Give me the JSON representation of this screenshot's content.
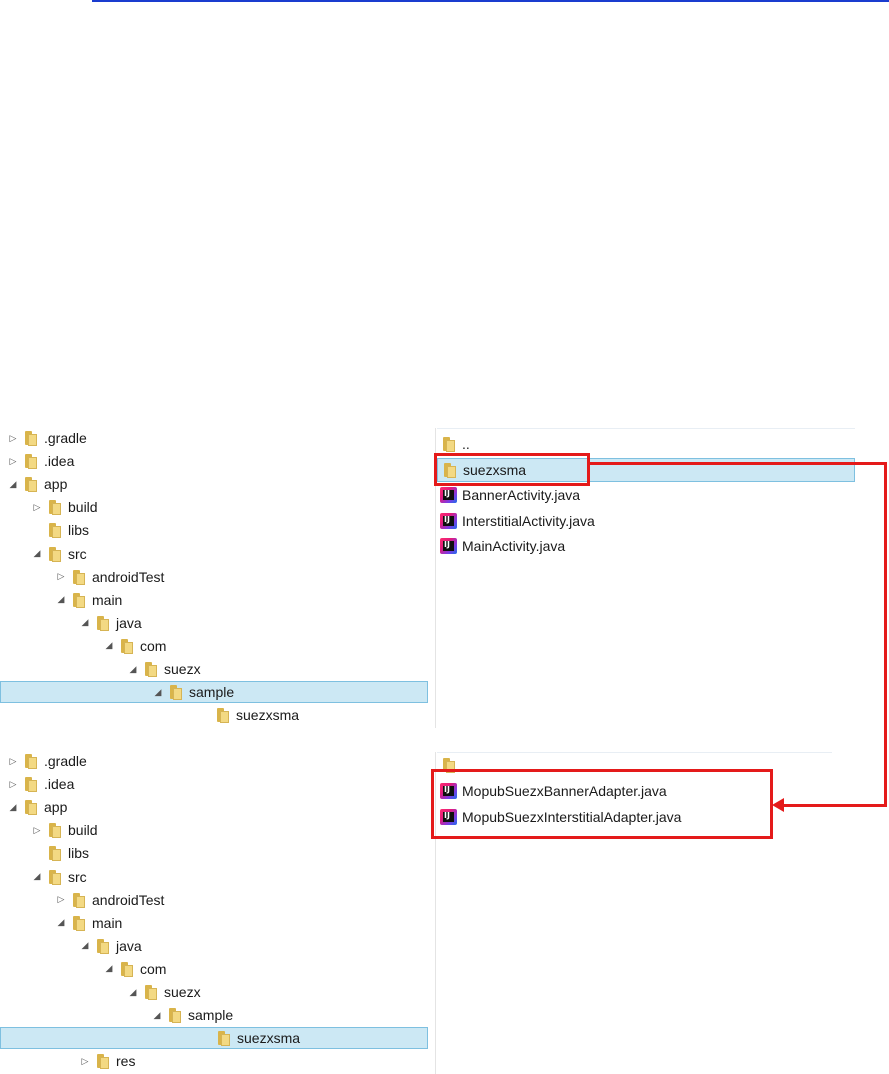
{
  "colors": {
    "selection": "#cce8f4",
    "selection_border": "#7ec0e0",
    "annotation": "#e41a1a",
    "link_line": "#1a3ccf"
  },
  "panel_top": {
    "tree": [
      {
        "label": ".gradle",
        "toggle": "▷"
      },
      {
        "label": ".idea",
        "toggle": "▷"
      },
      {
        "label": "app",
        "toggle": "◢"
      },
      {
        "label": "build",
        "toggle": "▷"
      },
      {
        "label": "libs",
        "toggle": ""
      },
      {
        "label": "src",
        "toggle": "◢"
      },
      {
        "label": "androidTest",
        "toggle": "▷"
      },
      {
        "label": "main",
        "toggle": "◢"
      },
      {
        "label": "java",
        "toggle": "◢"
      },
      {
        "label": "com",
        "toggle": "◢"
      },
      {
        "label": "suezx",
        "toggle": "◢"
      },
      {
        "label": "sample",
        "toggle": "◢",
        "selected": true
      },
      {
        "label": "suezxsma",
        "toggle": ""
      }
    ],
    "files": [
      {
        "name": "..",
        "icon": "folder-icon"
      },
      {
        "name": "suezxsma",
        "icon": "folder-icon",
        "selected": true
      },
      {
        "name": "BannerActivity.java",
        "icon": "intellij-java-icon"
      },
      {
        "name": "InterstitialActivity.java",
        "icon": "intellij-java-icon"
      },
      {
        "name": "MainActivity.java",
        "icon": "intellij-java-icon"
      }
    ]
  },
  "panel_bottom": {
    "tree": [
      {
        "label": ".gradle",
        "toggle": "▷"
      },
      {
        "label": ".idea",
        "toggle": "▷"
      },
      {
        "label": "app",
        "toggle": "◢"
      },
      {
        "label": "build",
        "toggle": "▷"
      },
      {
        "label": "libs",
        "toggle": ""
      },
      {
        "label": "src",
        "toggle": "◢"
      },
      {
        "label": "androidTest",
        "toggle": "▷"
      },
      {
        "label": "main",
        "toggle": "◢"
      },
      {
        "label": "java",
        "toggle": "◢"
      },
      {
        "label": "com",
        "toggle": "◢"
      },
      {
        "label": "suezx",
        "toggle": "◢"
      },
      {
        "label": "sample",
        "toggle": "◢"
      },
      {
        "label": "suezxsma",
        "toggle": "",
        "selected": true
      },
      {
        "label": "res",
        "toggle": "▷"
      }
    ],
    "files": [
      {
        "name": "",
        "icon": "folder-icon"
      },
      {
        "name": "MopubSuezxBannerAdapter.java",
        "icon": "intellij-java-icon"
      },
      {
        "name": "MopubSuezxInterstitialAdapter.java",
        "icon": "intellij-java-icon"
      }
    ]
  }
}
